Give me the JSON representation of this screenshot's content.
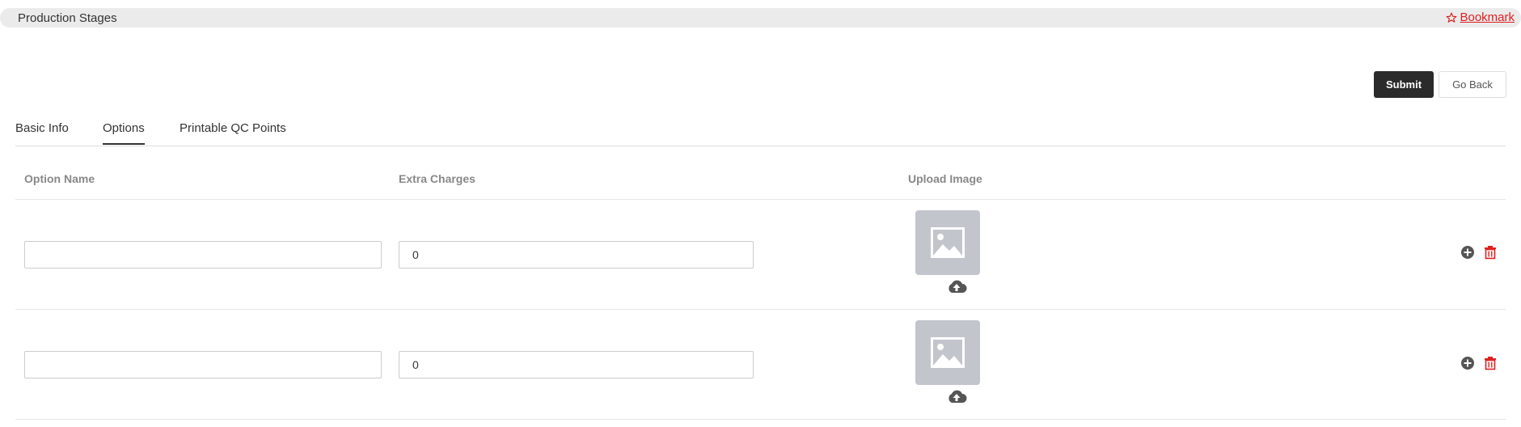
{
  "header": {
    "title": "Production Stages",
    "bookmark_label": "Bookmark"
  },
  "actions": {
    "submit_label": "Submit",
    "back_label": "Go Back"
  },
  "tabs": [
    {
      "label": "Basic Info",
      "active": false
    },
    {
      "label": "Options",
      "active": true
    },
    {
      "label": "Printable QC Points",
      "active": false
    }
  ],
  "table": {
    "columns": [
      "Option Name",
      "Extra Charges",
      "Upload Image"
    ],
    "rows": [
      {
        "option_name": "",
        "extra_charges": "0"
      },
      {
        "option_name": "",
        "extra_charges": "0"
      }
    ]
  },
  "icons": {
    "bookmark": "star-outline-icon",
    "image_placeholder": "image-placeholder-icon",
    "upload": "cloud-upload-icon",
    "add": "plus-circle-icon",
    "delete": "trash-icon"
  },
  "colors": {
    "accent_red": "#e02020",
    "submit_bg": "#2b2b2b",
    "placeholder_gray": "#c2c5cc"
  }
}
